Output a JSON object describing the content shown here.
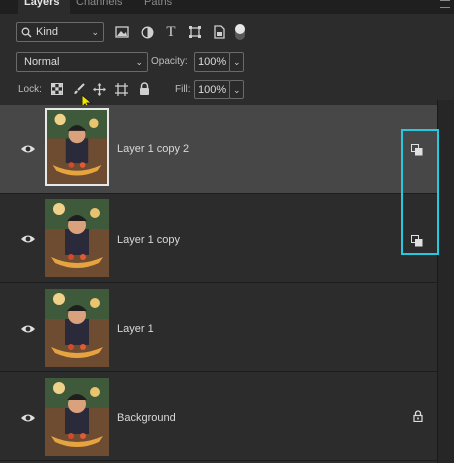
{
  "tabs": [
    {
      "label": "Layers",
      "active": true
    },
    {
      "label": "Channels",
      "active": false
    },
    {
      "label": "Paths",
      "active": false
    }
  ],
  "filter": {
    "kind_label": "Kind",
    "icons": [
      "image-filter-icon",
      "adjustment-filter-icon",
      "type-filter-icon",
      "shape-filter-icon",
      "smart-object-filter-icon",
      "filter-toggle-icon"
    ]
  },
  "blend": {
    "mode": "Normal",
    "opacity_label": "Opacity:",
    "opacity_value": "100%"
  },
  "lock": {
    "label": "Lock:",
    "icons": [
      "lock-transparent-pixels-icon",
      "lock-image-pixels-icon",
      "lock-position-icon",
      "lock-artboard-icon",
      "lock-all-icon"
    ],
    "fill_label": "Fill:",
    "fill_value": "100%"
  },
  "layers": [
    {
      "name": "Layer 1 copy 2",
      "selected": true,
      "badge": "smart-object-icon"
    },
    {
      "name": "Layer 1 copy",
      "selected": false,
      "badge": "smart-object-icon"
    },
    {
      "name": "Layer 1",
      "selected": false,
      "badge": ""
    },
    {
      "name": "Background",
      "selected": false,
      "badge": "lock-icon"
    }
  ],
  "colors": {
    "panel": "#2c2c2c",
    "selected_row": "#474747",
    "highlight": "#27c9e0"
  }
}
